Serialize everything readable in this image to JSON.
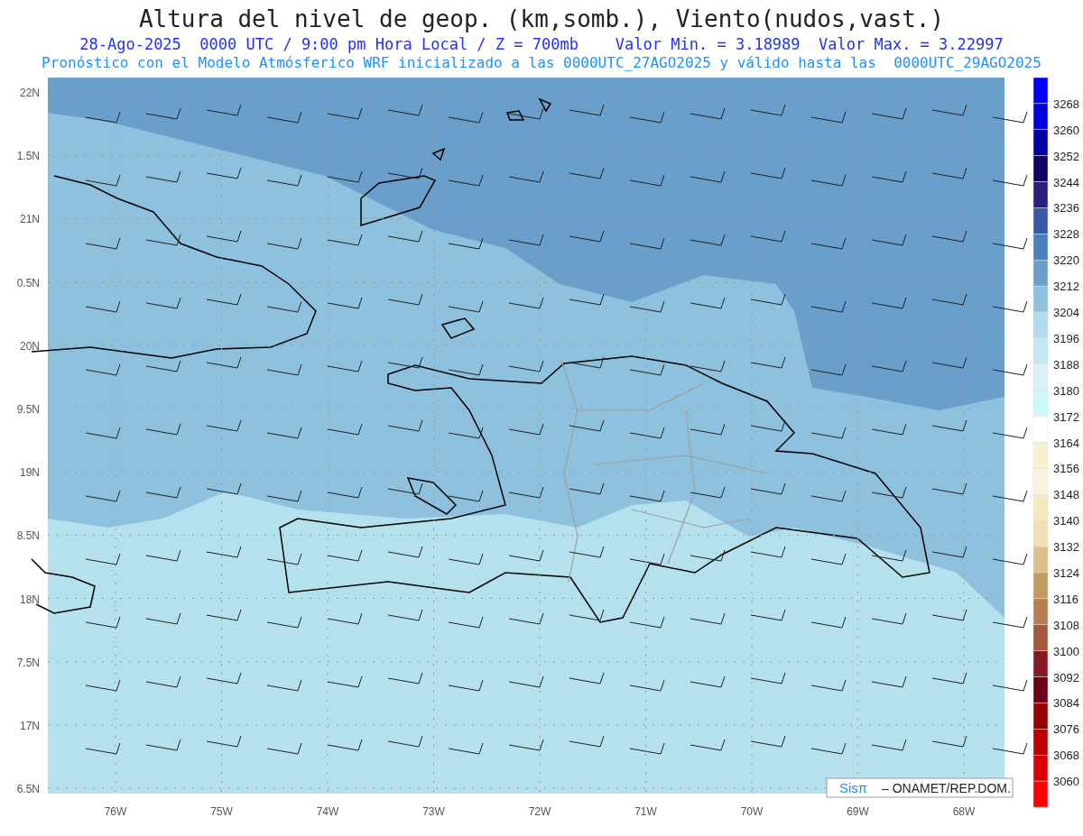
{
  "title": "Altura del nivel de geop. (km,somb.), Viento(nudos,vast.)",
  "subtitle": "28-Ago-2025  0000 UTC / 9:00 pm Hora Local / Z = 700mb    Valor Min. = 3.18989  Valor Max. = 3.22997",
  "forecast_note": "Pronóstico con el Modelo Atmósferico WRF inicializado a las 0000UTC_27AGO2025 y válido hasta las  0000UTC_29AGO2025",
  "y_axis_labels": [
    "22N",
    "1.5N",
    "21N",
    "0.5N",
    "20N",
    "9.5N",
    "19N",
    "8.5N",
    "18N",
    "7.5N",
    "17N",
    "6.5N"
  ],
  "x_axis_labels": [
    "76W",
    "75W",
    "74W",
    "73W",
    "72W",
    "71W",
    "70W",
    "69W",
    "68W"
  ],
  "colorbar": {
    "segments": [
      {
        "color": "#0000ff"
      },
      {
        "color": "#0000dd"
      },
      {
        "color": "#0000a8"
      },
      {
        "color": "#140066"
      },
      {
        "color": "#2a1f7e"
      },
      {
        "color": "#3a56a6"
      },
      {
        "color": "#4a80bf"
      },
      {
        "color": "#6a9ecb"
      },
      {
        "color": "#8ec1de"
      },
      {
        "color": "#b1dced"
      },
      {
        "color": "#c2e9f3"
      },
      {
        "color": "#dcf1f7"
      },
      {
        "color": "#ccf7fb"
      },
      {
        "color": "#ffffff"
      },
      {
        "color": "#f8f1cf"
      },
      {
        "color": "#faf3e1"
      },
      {
        "color": "#f5e9c4"
      },
      {
        "color": "#eedfb5"
      },
      {
        "color": "#dcc08c"
      },
      {
        "color": "#c49a62"
      },
      {
        "color": "#b87d50"
      },
      {
        "color": "#a3583c"
      },
      {
        "color": "#861a24"
      },
      {
        "color": "#6b0018"
      },
      {
        "color": "#990000"
      },
      {
        "color": "#c00000"
      },
      {
        "color": "#dd0000"
      },
      {
        "color": "#ff0000"
      }
    ],
    "labels": [
      "3268",
      "3260",
      "3252",
      "3244",
      "3236",
      "3228",
      "3220",
      "3212",
      "3204",
      "3196",
      "3188",
      "3180",
      "3172",
      "3164",
      "3156",
      "3148",
      "3140",
      "3132",
      "3124",
      "3116",
      "3108",
      "3100",
      "3092",
      "3084",
      "3076",
      "3068",
      "3060"
    ]
  },
  "credit": {
    "logo": "Sisπ",
    "text": "– ONAMET/REP.DOM."
  }
}
